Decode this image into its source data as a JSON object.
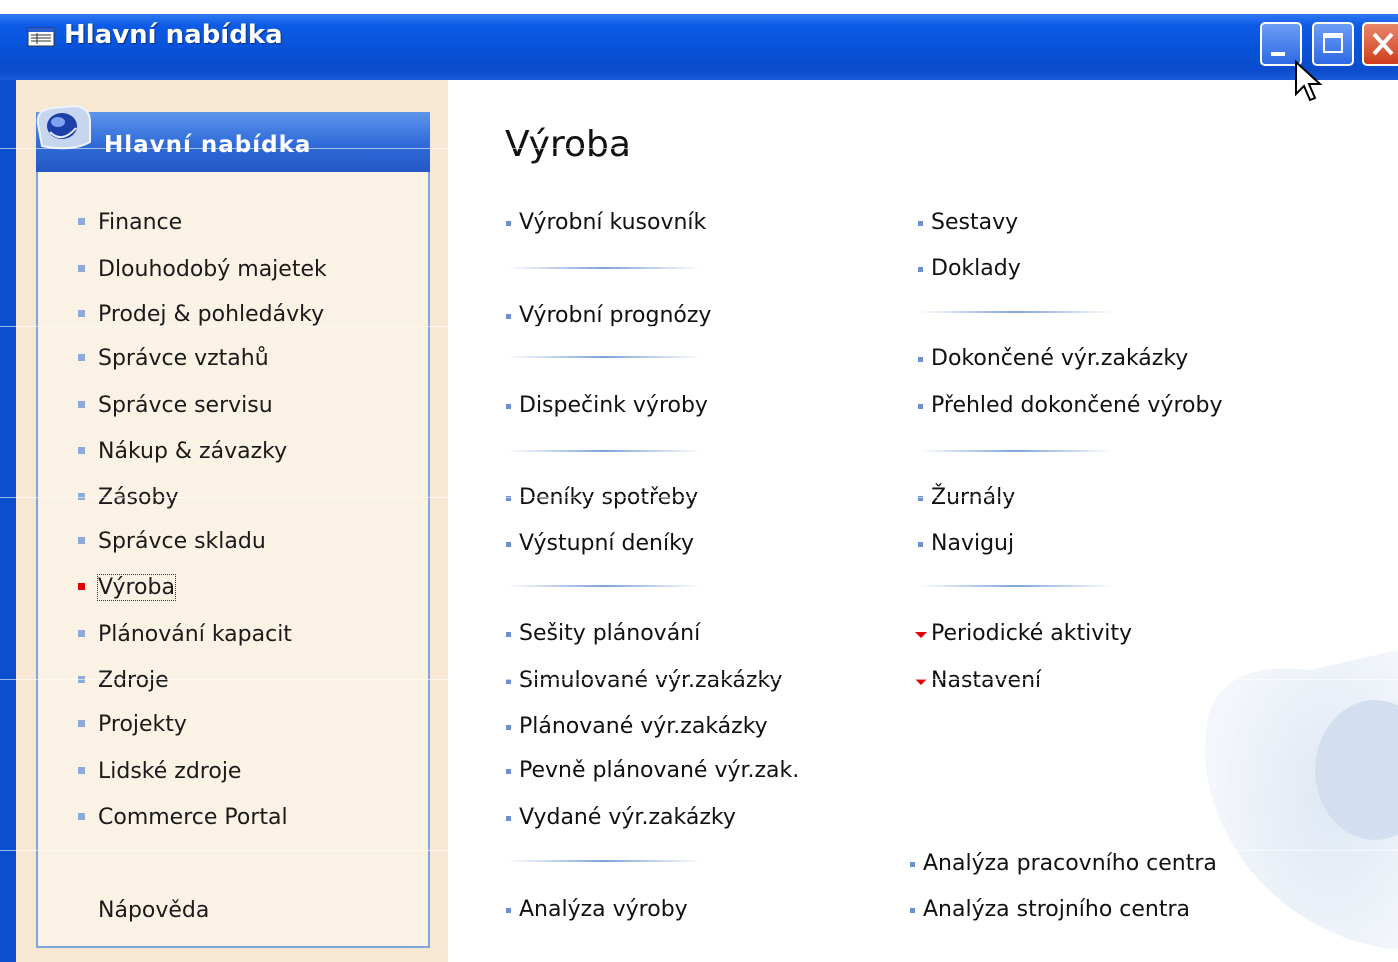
{
  "window": {
    "title": "Hlavní nabídka",
    "icons": {
      "app": "menu-window-icon",
      "minimize": "minimize-icon",
      "maximize": "maximize-icon",
      "close": "close-icon"
    }
  },
  "sidebar": {
    "header": "Hlavní nabídka",
    "items": [
      {
        "label": "Finance",
        "active": false
      },
      {
        "label": "Dlouhodobý majetek",
        "active": false
      },
      {
        "label": "Prodej & pohledávky",
        "active": false
      },
      {
        "label": "Správce vztahů",
        "active": false
      },
      {
        "label": "Správce servisu",
        "active": false
      },
      {
        "label": "Nákup & závazky",
        "active": false
      },
      {
        "label": "Zásoby",
        "active": false
      },
      {
        "label": "Správce skladu",
        "active": false
      },
      {
        "label": "Výroba",
        "active": true
      },
      {
        "label": "Plánování kapacit",
        "active": false
      },
      {
        "label": "Zdroje",
        "active": false
      },
      {
        "label": "Projekty",
        "active": false
      },
      {
        "label": "Lidské zdroje",
        "active": false
      },
      {
        "label": "Commerce Portal",
        "active": false
      }
    ],
    "help": "Nápověda"
  },
  "main": {
    "title": "Výroba",
    "col1": [
      "Výrobní kusovník",
      "Výrobní prognózy",
      "Dispečink výroby",
      "Deníky spotřeby",
      "Výstupní deníky",
      "Sešity plánování",
      "Simulované výr.zakázky",
      "Plánované výr.zakázky",
      "Pevně plánované výr.zak.",
      "Vydané výr.zakázky",
      "Analýza výroby"
    ],
    "col2": [
      "Sestavy",
      "Doklady",
      "Dokončené výr.zakázky",
      "Přehled dokončené výroby",
      "Žurnály",
      "Naviguj",
      "Periodické aktivity",
      "Nastavení",
      "Analýza pracovního centra",
      "Analýza strojního centra"
    ]
  },
  "colors": {
    "titlebar": "#0852d8",
    "panel": "#f8e8d3",
    "active_bullet": "#e00000",
    "bullet": "#8fa9d9"
  }
}
